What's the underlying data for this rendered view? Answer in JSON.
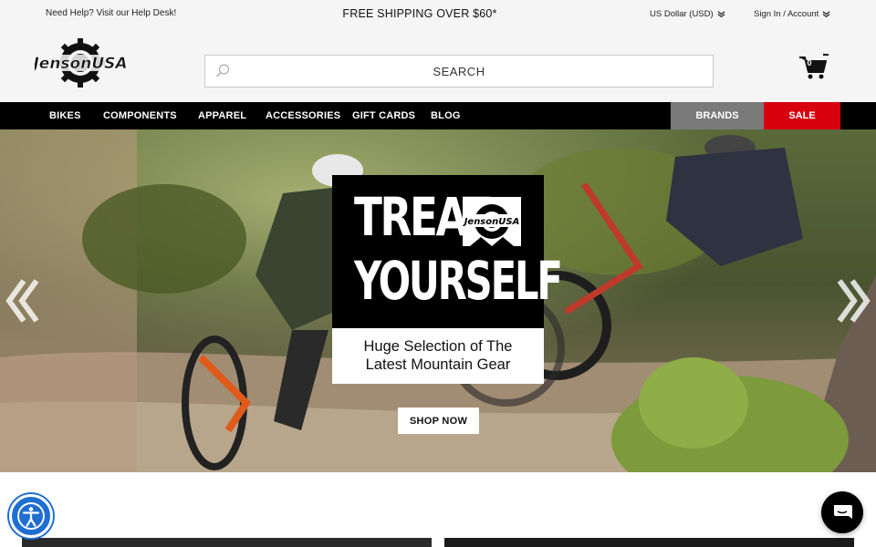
{
  "utility_bar": {
    "help_text": "Need Help? Visit our Help Desk!",
    "shipping_text": "FREE SHIPPING OVER $60*",
    "currency_label": "US Dollar (USD)",
    "account_label": "Sign In / Account"
  },
  "header": {
    "logo_text": "JensonUSA",
    "search_placeholder": "SEARCH",
    "cart_count": "0"
  },
  "nav": {
    "items": [
      "BIKES",
      "COMPONENTS",
      "APPAREL",
      "ACCESSORIES",
      "GIFT CARDS",
      "BLOG"
    ],
    "brands_label": "BRANDS",
    "sale_label": "SALE"
  },
  "hero": {
    "headline_line1": "TREAT",
    "headline_line2": "YOURSELF",
    "badge_text": "JensonUSA",
    "subtext": "Huge Selection of The\nLatest Mountain Gear",
    "cta_label": "SHOP NOW"
  },
  "colors": {
    "nav_bg": "#000000",
    "brands_bg": "#7a7a7a",
    "sale_bg": "#d6000f",
    "utility_bg": "#f5f5f5",
    "accessibility_blue": "#1f6fd1"
  },
  "icons": {
    "search": "search-icon",
    "cart": "cart-icon",
    "chevron": "chevron-down-double-icon",
    "prev": "chevron-left-double-icon",
    "next": "chevron-right-double-icon",
    "accessibility": "accessibility-icon",
    "chat": "chat-icon"
  }
}
